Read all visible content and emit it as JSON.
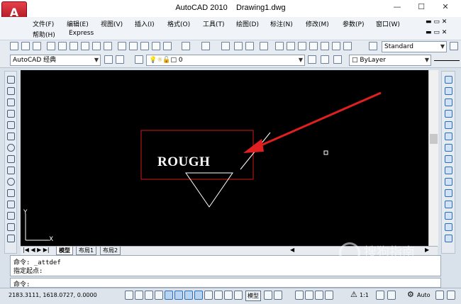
{
  "window": {
    "title": "AutoCAD 2010",
    "document": "Drawing1.dwg",
    "app_icon": "A"
  },
  "menu": {
    "row1": [
      "文件(F)",
      "编辑(E)",
      "视图(V)",
      "插入(I)",
      "格式(O)",
      "工具(T)",
      "绘图(D)",
      "标注(N)",
      "修改(M)",
      "参数(P)",
      "窗口(W)"
    ],
    "row2": [
      "帮助(H)",
      "Express"
    ]
  },
  "toolbar": {
    "workspace": "AutoCAD 经典",
    "layer_value": "0",
    "text_style": "Standard",
    "color": "ByLayer"
  },
  "drawing": {
    "attribute_text": "ROUGH",
    "colors": {
      "frame": "#d01818",
      "arrow": "#e02020",
      "text": "#ffffff",
      "triangle": "#ffffff"
    }
  },
  "layout_tabs": [
    "模型",
    "布局1",
    "布局2"
  ],
  "command": {
    "line1": "命令:  _attdef",
    "line2": "指定起点:",
    "prompt": "命令:"
  },
  "status": {
    "coords": "2183.3111, 1618.0727, 0.0000",
    "model_label": "模型",
    "scale": "1:1",
    "auto": "Auto"
  },
  "watermark": {
    "text": "搜狗指南",
    "sub": "zhinan.sogou.com"
  },
  "ucs": {
    "x_label": "X",
    "y_label": "Y"
  }
}
